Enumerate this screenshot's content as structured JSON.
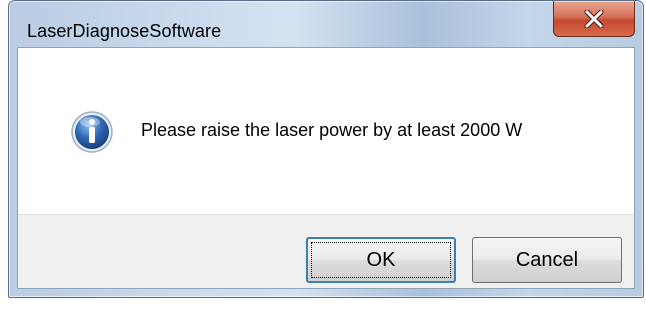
{
  "window": {
    "title": "LaserDiagnoseSoftware"
  },
  "titlebar": {
    "close_icon": "close-x-icon"
  },
  "dialog": {
    "icon": "information-icon",
    "message": "Please raise the laser power by at least 2000 W"
  },
  "buttons": {
    "ok_label": "OK",
    "cancel_label": "Cancel"
  },
  "colors": {
    "close_button": "#c64a2f",
    "focus_border": "#3c7fb1",
    "info_icon": "#2f67b5"
  }
}
